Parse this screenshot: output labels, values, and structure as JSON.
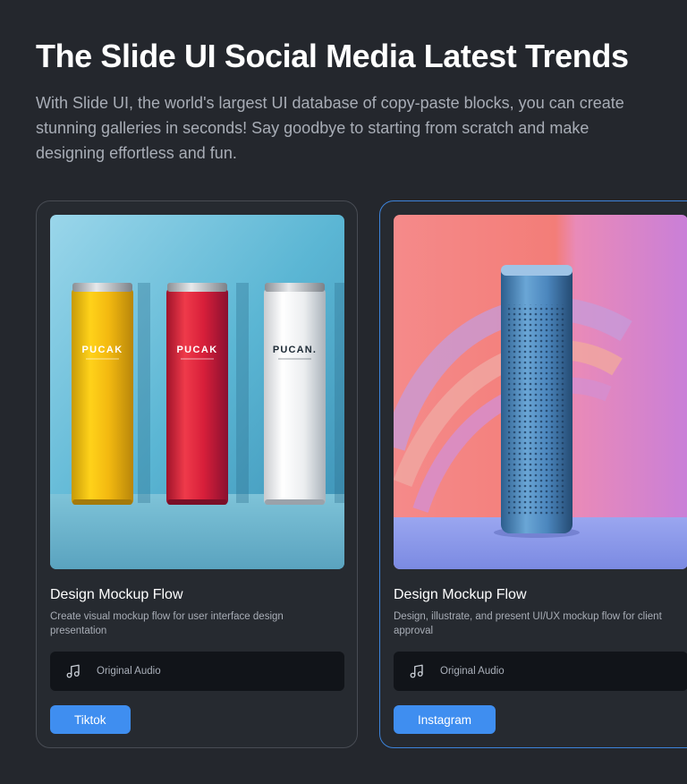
{
  "header": {
    "title": "The Slide UI Social Media Latest Trends",
    "description": "With Slide UI, the world's largest UI database of copy-paste blocks, you can create stunning galleries in seconds! Say goodbye to starting from scratch and make designing effortless and fun."
  },
  "cards": [
    {
      "image_label": "PUCAK",
      "image_label_alt": "PUCAN.",
      "title": "Design Mockup Flow",
      "description": "Create visual mockup flow for user interface design presentation",
      "audio_label": "Original Audio",
      "platform_label": "Tiktok"
    },
    {
      "title": "Design Mockup Flow",
      "description": "Design, illustrate, and present UI/UX mockup flow for client approval",
      "audio_label": "Original Audio",
      "platform_label": "Instagram"
    }
  ],
  "colors": {
    "background": "#24272d",
    "accent": "#3f8ef0",
    "active_border": "#3d83da"
  },
  "icons": {
    "audio": "music-note-icon"
  }
}
